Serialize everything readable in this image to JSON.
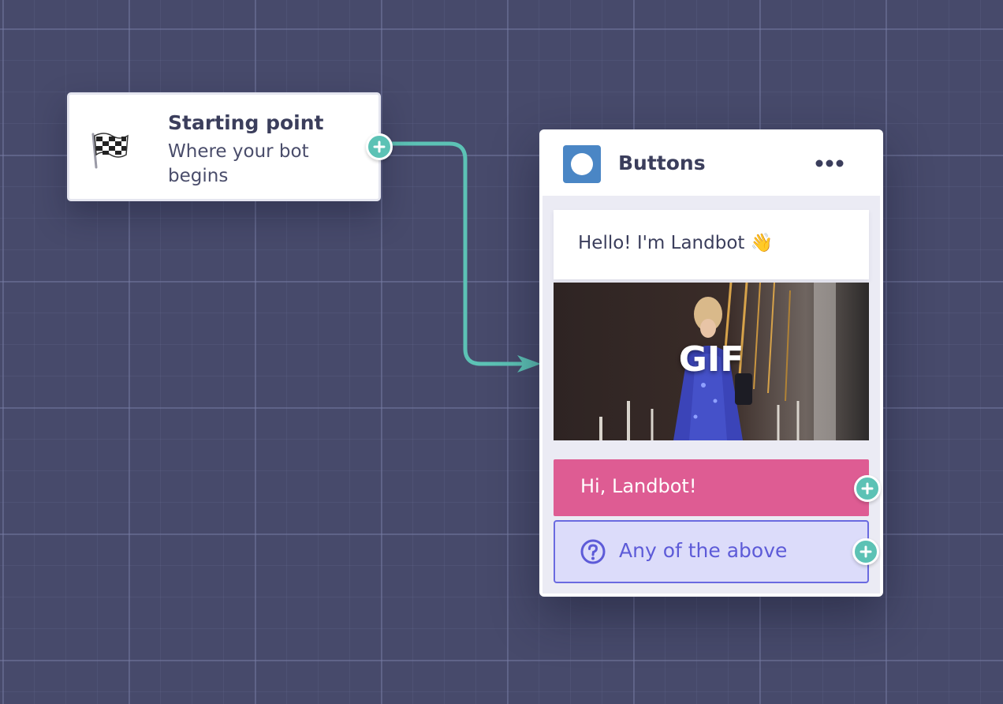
{
  "canvas": {
    "background_color": "#474a6b",
    "connector_color": "#5cc2b5"
  },
  "start_node": {
    "icon": "checkered-flag-icon",
    "title": "Starting point",
    "subtitle": "Where your bot begins"
  },
  "buttons_node": {
    "icon": "button-block-icon",
    "title": "Buttons",
    "menu_icon": "more-horizontal-icon",
    "message": "Hello! I'm Landbot 👋",
    "media_label": "GIF",
    "reply_button_label": "Hi, Landbot!",
    "fallback_label": "Any of the above",
    "fallback_icon": "question-circle-icon"
  },
  "colors": {
    "accent_teal": "#5cc2b5",
    "reply_pink": "#de5c93",
    "fallback_border": "#6a6ae0",
    "fallback_text": "#5d5bd8",
    "block_icon_blue": "#4a86c5"
  }
}
